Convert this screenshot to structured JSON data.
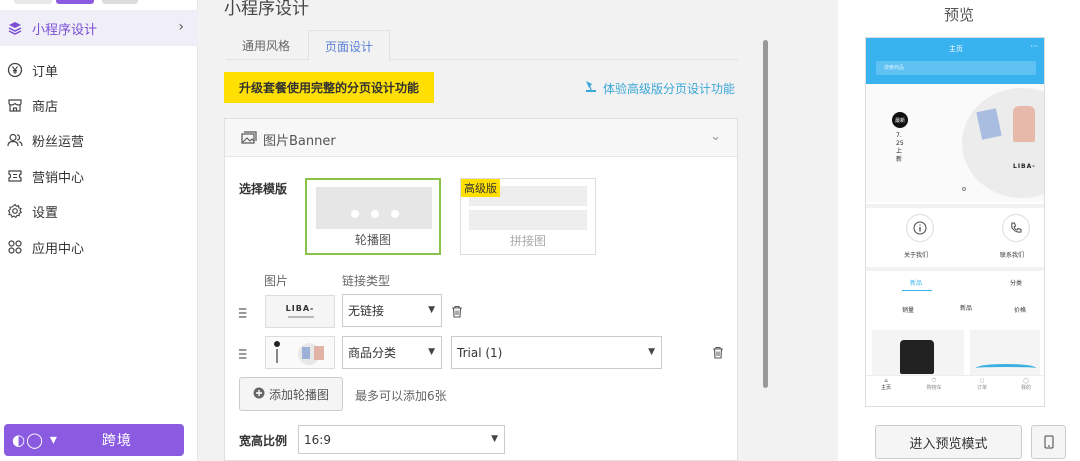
{
  "sidebar": {
    "items": [
      {
        "label": "小程序设计",
        "icon": "layers-icon",
        "active": true
      },
      {
        "label": "订单",
        "icon": "yen-icon"
      },
      {
        "label": "商店",
        "icon": "store-icon"
      },
      {
        "label": "粉丝运营",
        "icon": "users-icon"
      },
      {
        "label": "营销中心",
        "icon": "ticket-icon"
      },
      {
        "label": "设置",
        "icon": "gear-icon"
      },
      {
        "label": "应用中心",
        "icon": "apps-icon"
      }
    ],
    "promo_label": "跨境"
  },
  "main": {
    "title": "小程序设计",
    "tabs": [
      {
        "label": "通用风格"
      },
      {
        "label": "页面设计",
        "active": true
      }
    ],
    "upgrade_label": "升级套餐使用完整的分页设计功能",
    "experience_link": "体验高级版分页设计功能",
    "card": {
      "title": "图片Banner",
      "template_label": "选择模版",
      "templates": [
        {
          "label": "轮播图",
          "selected": true
        },
        {
          "label": "拼接图",
          "badge": "高级版"
        }
      ],
      "col_image": "图片",
      "col_link_type": "链接类型",
      "rows": [
        {
          "thumb_text": "LIBA-",
          "link_type": "无链接"
        },
        {
          "link_type": "商品分类",
          "target": "Trial (1)"
        }
      ],
      "add_label": "添加轮播图",
      "add_hint": "最多可以添加6张",
      "ratio_label": "宽高比例",
      "ratio_value": "16:9"
    }
  },
  "preview": {
    "title": "预览",
    "phone": {
      "header_title": "主页",
      "more": "···",
      "search_placeholder": "搜索商品",
      "banner_badge": "最新",
      "banner_vertical": "7.25 上新",
      "banner_brand": "LIBA-",
      "icon_labels": [
        "关于我们",
        "联系我们"
      ],
      "tabs": [
        "新品",
        "分类"
      ],
      "sorts": [
        "销量",
        "新品",
        "价格"
      ],
      "bottom_tabs": [
        "主页",
        "购物车",
        "订单",
        "我的"
      ]
    },
    "enter_label": "进入预览模式"
  },
  "colors": {
    "accent": "#8a5be0",
    "upgrade_bg": "#ffe000",
    "link": "#3aa7d8",
    "phone_header": "#39b3ef",
    "selected_border": "#8bc34a"
  }
}
